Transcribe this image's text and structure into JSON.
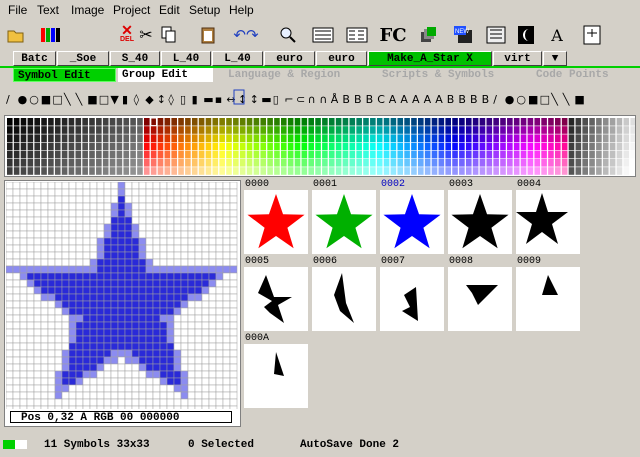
{
  "menu": {
    "items": [
      "File",
      "Text",
      "Image",
      "Project",
      "Edit",
      "Setup",
      "Help"
    ]
  },
  "toolbar": {
    "buttons": [
      {
        "name": "open-folder-icon"
      },
      {
        "name": "color-bars-icon"
      },
      {
        "name": "delete-icon",
        "label": "DEL"
      },
      {
        "name": "cut-icon"
      },
      {
        "name": "copy-icon"
      },
      {
        "name": "clipboard-icon"
      },
      {
        "name": "undo-icon"
      },
      {
        "name": "magnifier-icon"
      },
      {
        "name": "grid-a-icon"
      },
      {
        "name": "text-grid-icon"
      },
      {
        "name": "fc-text-icon",
        "label": "FC"
      },
      {
        "name": "stack-icon"
      },
      {
        "name": "new-icon"
      },
      {
        "name": "contrast-icon"
      },
      {
        "name": "typeface-icon"
      },
      {
        "name": "export-icon"
      }
    ]
  },
  "project_tabs": [
    "Batc",
    "_Soe",
    "S_40",
    "L_40",
    "L_40",
    "euro",
    "euro",
    "Make_A_Star X",
    "virt",
    "▼"
  ],
  "sub_tabs": [
    "Symbol Edit",
    "Group Edit",
    "Language & Region",
    "Scripts & Symbols",
    "Code Points"
  ],
  "editor": {
    "pos_text": "Pos 0,32  A RGB 00 000000"
  },
  "symbols": [
    {
      "id": "0000",
      "color": "#ff0000",
      "shape": "star"
    },
    {
      "id": "0001",
      "color": "#00b000",
      "shape": "star"
    },
    {
      "id": "0002",
      "color": "#0000ff",
      "shape": "star",
      "selected": true
    },
    {
      "id": "0003",
      "color": "#000000",
      "shape": "star"
    },
    {
      "id": "0004",
      "color": "#000000",
      "shape": "half"
    },
    {
      "id": "0005",
      "color": "#000000",
      "shape": "f1"
    },
    {
      "id": "0006",
      "color": "#000000",
      "shape": "f2"
    },
    {
      "id": "0007",
      "color": "#000000",
      "shape": "f3"
    },
    {
      "id": "0008",
      "color": "#000000",
      "shape": "f4"
    },
    {
      "id": "0009",
      "color": "#000000",
      "shape": "f5"
    },
    {
      "id": "000A",
      "color": "#000000",
      "shape": "f6"
    }
  ],
  "status": {
    "symbols": "11 Symbols 33x33",
    "selected": "0 Selected",
    "autosave": "AutoSave Done 2"
  },
  "colors": {
    "accent_green": "#00d000",
    "selected_id": "#0000c0",
    "star_blue": "#2a2ad8"
  }
}
